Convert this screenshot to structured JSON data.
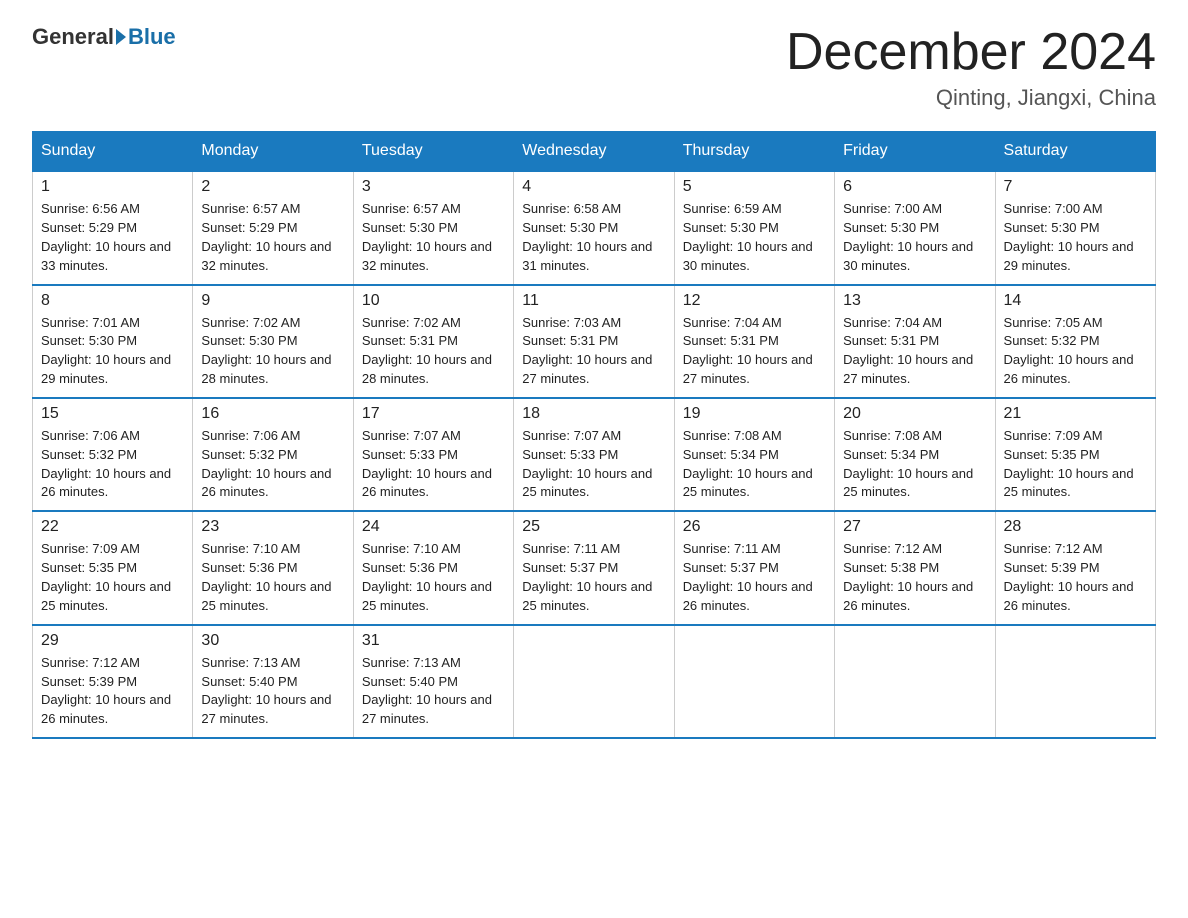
{
  "logo": {
    "text_general": "General",
    "text_blue": "Blue"
  },
  "header": {
    "month_year": "December 2024",
    "location": "Qinting, Jiangxi, China"
  },
  "weekdays": [
    "Sunday",
    "Monday",
    "Tuesday",
    "Wednesday",
    "Thursday",
    "Friday",
    "Saturday"
  ],
  "weeks": [
    [
      {
        "day": "1",
        "sunrise": "6:56 AM",
        "sunset": "5:29 PM",
        "daylight": "10 hours and 33 minutes."
      },
      {
        "day": "2",
        "sunrise": "6:57 AM",
        "sunset": "5:29 PM",
        "daylight": "10 hours and 32 minutes."
      },
      {
        "day": "3",
        "sunrise": "6:57 AM",
        "sunset": "5:30 PM",
        "daylight": "10 hours and 32 minutes."
      },
      {
        "day": "4",
        "sunrise": "6:58 AM",
        "sunset": "5:30 PM",
        "daylight": "10 hours and 31 minutes."
      },
      {
        "day": "5",
        "sunrise": "6:59 AM",
        "sunset": "5:30 PM",
        "daylight": "10 hours and 30 minutes."
      },
      {
        "day": "6",
        "sunrise": "7:00 AM",
        "sunset": "5:30 PM",
        "daylight": "10 hours and 30 minutes."
      },
      {
        "day": "7",
        "sunrise": "7:00 AM",
        "sunset": "5:30 PM",
        "daylight": "10 hours and 29 minutes."
      }
    ],
    [
      {
        "day": "8",
        "sunrise": "7:01 AM",
        "sunset": "5:30 PM",
        "daylight": "10 hours and 29 minutes."
      },
      {
        "day": "9",
        "sunrise": "7:02 AM",
        "sunset": "5:30 PM",
        "daylight": "10 hours and 28 minutes."
      },
      {
        "day": "10",
        "sunrise": "7:02 AM",
        "sunset": "5:31 PM",
        "daylight": "10 hours and 28 minutes."
      },
      {
        "day": "11",
        "sunrise": "7:03 AM",
        "sunset": "5:31 PM",
        "daylight": "10 hours and 27 minutes."
      },
      {
        "day": "12",
        "sunrise": "7:04 AM",
        "sunset": "5:31 PM",
        "daylight": "10 hours and 27 minutes."
      },
      {
        "day": "13",
        "sunrise": "7:04 AM",
        "sunset": "5:31 PM",
        "daylight": "10 hours and 27 minutes."
      },
      {
        "day": "14",
        "sunrise": "7:05 AM",
        "sunset": "5:32 PM",
        "daylight": "10 hours and 26 minutes."
      }
    ],
    [
      {
        "day": "15",
        "sunrise": "7:06 AM",
        "sunset": "5:32 PM",
        "daylight": "10 hours and 26 minutes."
      },
      {
        "day": "16",
        "sunrise": "7:06 AM",
        "sunset": "5:32 PM",
        "daylight": "10 hours and 26 minutes."
      },
      {
        "day": "17",
        "sunrise": "7:07 AM",
        "sunset": "5:33 PM",
        "daylight": "10 hours and 26 minutes."
      },
      {
        "day": "18",
        "sunrise": "7:07 AM",
        "sunset": "5:33 PM",
        "daylight": "10 hours and 25 minutes."
      },
      {
        "day": "19",
        "sunrise": "7:08 AM",
        "sunset": "5:34 PM",
        "daylight": "10 hours and 25 minutes."
      },
      {
        "day": "20",
        "sunrise": "7:08 AM",
        "sunset": "5:34 PM",
        "daylight": "10 hours and 25 minutes."
      },
      {
        "day": "21",
        "sunrise": "7:09 AM",
        "sunset": "5:35 PM",
        "daylight": "10 hours and 25 minutes."
      }
    ],
    [
      {
        "day": "22",
        "sunrise": "7:09 AM",
        "sunset": "5:35 PM",
        "daylight": "10 hours and 25 minutes."
      },
      {
        "day": "23",
        "sunrise": "7:10 AM",
        "sunset": "5:36 PM",
        "daylight": "10 hours and 25 minutes."
      },
      {
        "day": "24",
        "sunrise": "7:10 AM",
        "sunset": "5:36 PM",
        "daylight": "10 hours and 25 minutes."
      },
      {
        "day": "25",
        "sunrise": "7:11 AM",
        "sunset": "5:37 PM",
        "daylight": "10 hours and 25 minutes."
      },
      {
        "day": "26",
        "sunrise": "7:11 AM",
        "sunset": "5:37 PM",
        "daylight": "10 hours and 26 minutes."
      },
      {
        "day": "27",
        "sunrise": "7:12 AM",
        "sunset": "5:38 PM",
        "daylight": "10 hours and 26 minutes."
      },
      {
        "day": "28",
        "sunrise": "7:12 AM",
        "sunset": "5:39 PM",
        "daylight": "10 hours and 26 minutes."
      }
    ],
    [
      {
        "day": "29",
        "sunrise": "7:12 AM",
        "sunset": "5:39 PM",
        "daylight": "10 hours and 26 minutes."
      },
      {
        "day": "30",
        "sunrise": "7:13 AM",
        "sunset": "5:40 PM",
        "daylight": "10 hours and 27 minutes."
      },
      {
        "day": "31",
        "sunrise": "7:13 AM",
        "sunset": "5:40 PM",
        "daylight": "10 hours and 27 minutes."
      },
      null,
      null,
      null,
      null
    ]
  ]
}
